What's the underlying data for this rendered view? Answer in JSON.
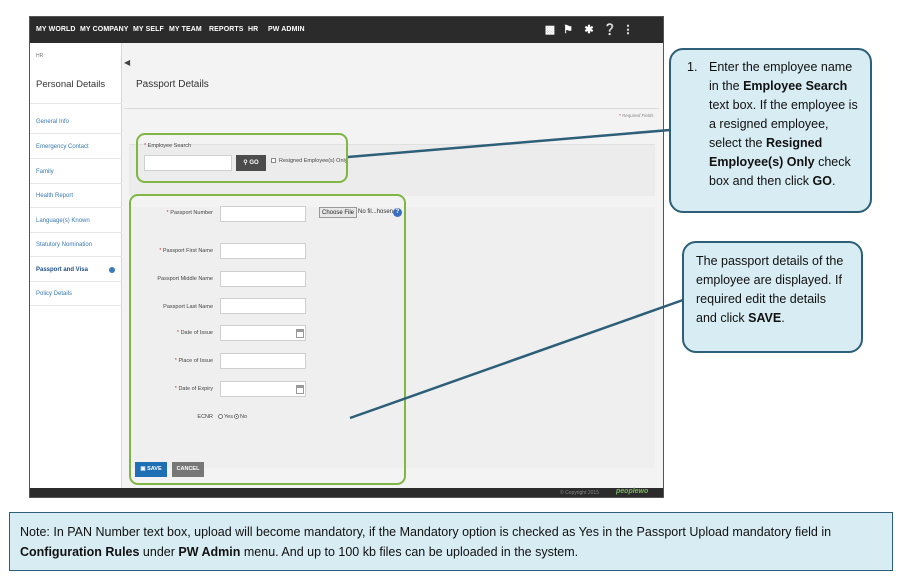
{
  "nav": {
    "items": [
      "MY WORLD",
      "MY COMPANY",
      "MY SELF",
      "MY TEAM",
      "REPORTS",
      "HR",
      "PW ADMIN"
    ]
  },
  "sidebar": {
    "breadcrumb": "HR",
    "title": "Personal Details",
    "items": [
      {
        "label": "General Info"
      },
      {
        "label": "Emergency Contact"
      },
      {
        "label": "Family"
      },
      {
        "label": "Health Report"
      },
      {
        "label": "Language(s) Known"
      },
      {
        "label": "Statutory Nomination"
      },
      {
        "label": "Passport and Visa"
      },
      {
        "label": "Policy Details"
      }
    ]
  },
  "main": {
    "title": "Passport Details",
    "required_note": "Required Fields",
    "search": {
      "label": "Employee Search",
      "go_label": "GO",
      "resigned_label": "Resigned Employee(s) Only"
    },
    "form": {
      "passport_number": "Passport Number",
      "choose_file": "Choose File",
      "file_status": "No fil...hosen",
      "first_name": "Passport First Name",
      "middle_name": "Passport Middle Name",
      "last_name": "Passport Last Name",
      "date_of_issue": "Date of Issue",
      "place_of_issue": "Place of Issue",
      "date_of_expiry": "Date of Expiry",
      "ecnr": "ECNR",
      "ecnr_yes": "Yes",
      "ecnr_no": "No"
    },
    "save_label": "SAVE",
    "cancel_label": "CANCEL"
  },
  "footer": {
    "copyright": "© Copyright 2015",
    "brand": "peoplewo"
  },
  "callouts": {
    "c1_num": "1.",
    "c1_a": "Enter the employee name in the ",
    "c1_b": "Employee Search",
    "c1_c": " text box. If the employee is a resigned employee, select the ",
    "c1_d": "Resigned Employee(s) Only",
    "c1_e": " check box and then click ",
    "c1_f": "GO",
    "c1_g": ".",
    "c2_a": "The passport details of the employee are displayed. If required edit the details and click ",
    "c2_b": "SAVE",
    "c2_c": "."
  },
  "note": {
    "a": "Note: In PAN Number text box, upload will become mandatory, if the Mandatory option is checked as Yes in the Passport Upload mandatory field in ",
    "b": "Configuration Rules",
    "c": " under ",
    "d": "PW Admin",
    "e": " menu. And up to 100 kb files can be uploaded in the system."
  }
}
